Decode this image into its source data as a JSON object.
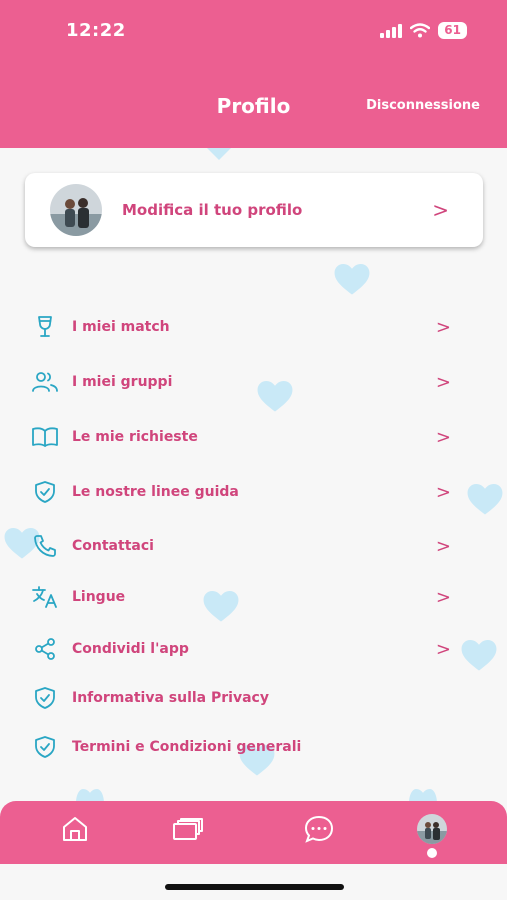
{
  "status_bar": {
    "time": "12:22",
    "battery": "61"
  },
  "header": {
    "title": "Profilo",
    "logout_label": "Disconnessione"
  },
  "profile_card": {
    "label": "Modifica il tuo profilo"
  },
  "menu": {
    "items": [
      {
        "label": "I miei match",
        "icon": "wine-glass-icon",
        "has_chevron": true
      },
      {
        "label": "I miei gruppi",
        "icon": "users-icon",
        "has_chevron": true
      },
      {
        "label": "Le mie richieste",
        "icon": "book-icon",
        "has_chevron": true
      },
      {
        "label": "Le nostre linee guida",
        "icon": "shield-check-icon",
        "has_chevron": true
      },
      {
        "label": "Contattaci",
        "icon": "phone-icon",
        "has_chevron": true
      },
      {
        "label": "Lingue",
        "icon": "translate-icon",
        "has_chevron": true
      },
      {
        "label": "Condividi l'app",
        "icon": "share-icon",
        "has_chevron": true
      },
      {
        "label": "Informativa sulla Privacy",
        "icon": "shield-check-icon",
        "has_chevron": false
      },
      {
        "label": "Termini e Condizioni generali",
        "icon": "shield-check-icon",
        "has_chevron": false
      }
    ]
  },
  "tabbar": {
    "tabs": [
      "home-icon",
      "cards-icon",
      "chat-icon",
      "profile-avatar"
    ],
    "active_tab": "profile-avatar"
  },
  "colors": {
    "brand_pink": "#ec5f91",
    "text_pink": "#d0457c",
    "icon_teal": "#2aa6c4",
    "heart_blue": "#c9e9f7",
    "background": "#f7f7f7"
  }
}
